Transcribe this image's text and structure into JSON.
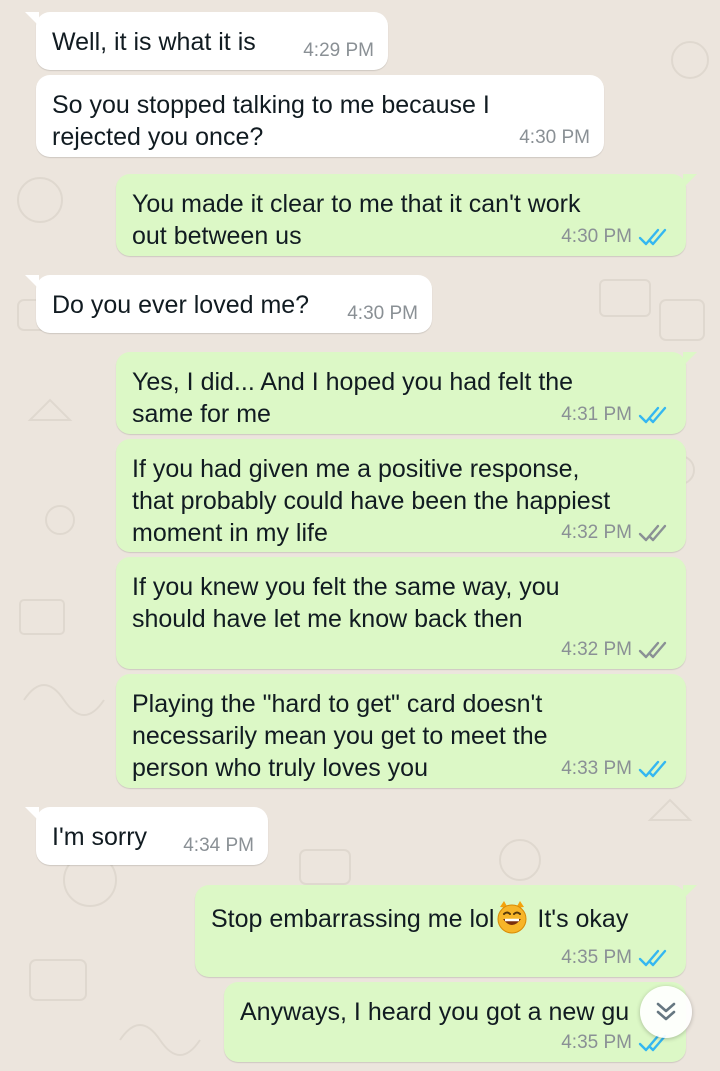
{
  "colors": {
    "incoming_bubble": "#ffffff",
    "outgoing_bubble": "#dcf8c6",
    "timestamp": "#8a9095",
    "read_ticks": "#34b7f1",
    "delivered_ticks": "#8a9095",
    "background": "#ece5dd"
  },
  "messages": [
    {
      "direction": "incoming",
      "text": "Well, it is what it is",
      "time": "4:29 PM"
    },
    {
      "direction": "incoming",
      "text": "So you stopped talking to me because I\nrejected you once?",
      "time": "4:30 PM"
    },
    {
      "direction": "outgoing",
      "text": "You made it clear to me that it can't work\nout between us",
      "time": "4:30 PM",
      "status": "read"
    },
    {
      "direction": "incoming",
      "text": "Do you ever loved me?",
      "time": "4:30 PM"
    },
    {
      "direction": "outgoing",
      "text": "Yes, I did... And I hoped you had felt the\nsame for me",
      "time": "4:31 PM",
      "status": "read"
    },
    {
      "direction": "outgoing",
      "text": "If you had given me a positive response,\nthat probably could have been the happiest\nmoment in my life",
      "time": "4:32 PM",
      "status": "delivered"
    },
    {
      "direction": "outgoing",
      "text": "If you knew you felt the same way, you\nshould have let me know back then",
      "time": "4:32 PM",
      "status": "delivered"
    },
    {
      "direction": "outgoing",
      "text": "Playing the \"hard to get\" card doesn't\nnecessarily mean you get to meet the\nperson who truly loves you",
      "time": "4:33 PM",
      "status": "read"
    },
    {
      "direction": "incoming",
      "text": "I'm sorry",
      "time": "4:34 PM"
    },
    {
      "direction": "outgoing",
      "text_before": "Stop embarrassing me lol",
      "emoji": "grinning-cat-icon",
      "text_after": " It's okay",
      "time": "4:35 PM",
      "status": "read"
    },
    {
      "direction": "outgoing",
      "text": "Anyways, I heard you got a new gu",
      "time": "4:35 PM",
      "status": "read"
    }
  ],
  "scroll_button": {
    "icon": "double-chevron-down-icon"
  }
}
